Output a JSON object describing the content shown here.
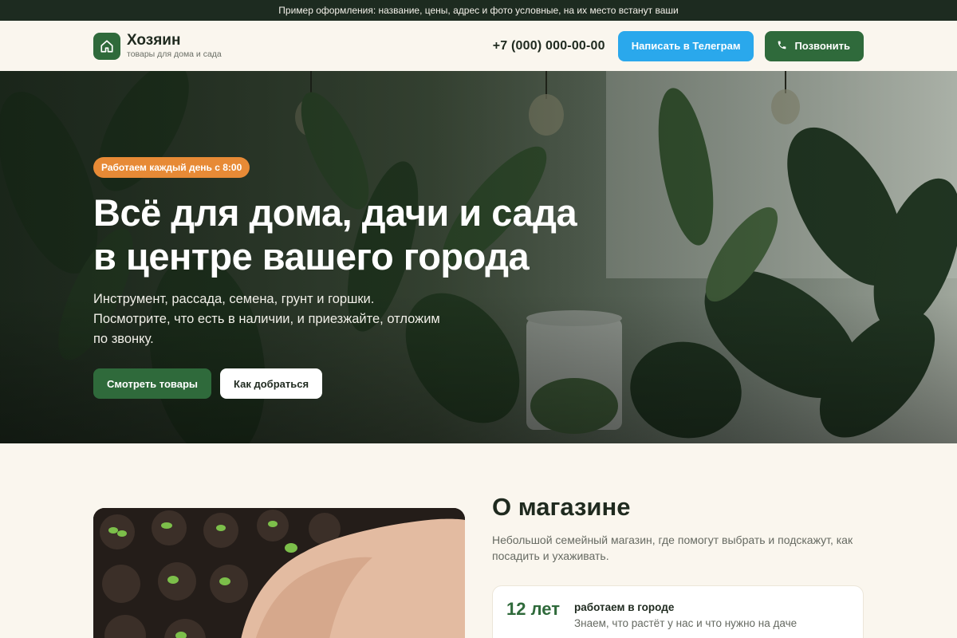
{
  "notice": "Пример оформления: название, цены, адрес и фото условные, на их место встанут ваши",
  "header": {
    "brand_name": "Хозяин",
    "brand_sub": "товары для дома и сада",
    "phone": "+7 (000) 000-00-00",
    "telegram_label": "Написать в Телеграм",
    "call_label": "Позвонить",
    "logo_icon": "home-icon",
    "call_icon": "phone-icon"
  },
  "hero": {
    "badge": "Работаем каждый день с 8:00",
    "title_line1": "Всё для дома, дачи и сада",
    "title_line2": "в центре вашего города",
    "desc_line1": "Инструмент, рассада, семена, грунт и горшки.",
    "desc_line2": "Посмотрите, что есть в наличии, и приезжайте, отложим",
    "desc_line3": "по звонку.",
    "primary_btn": "Смотреть товары",
    "secondary_btn": "Как добраться"
  },
  "about": {
    "title": "О магазине",
    "description": "Небольшой семейный магазин, где помогут выбрать и подскажут, как посадить и ухаживать.",
    "stats": [
      {
        "value": "12 лет",
        "label": "работаем в городе",
        "desc": "Знаем, что растёт у нас и что нужно на даче"
      }
    ]
  },
  "colors": {
    "brand_green": "#2f6a3b",
    "telegram_blue": "#2aa8ec",
    "badge_orange": "#e78a36",
    "background": "#faf6ee"
  }
}
